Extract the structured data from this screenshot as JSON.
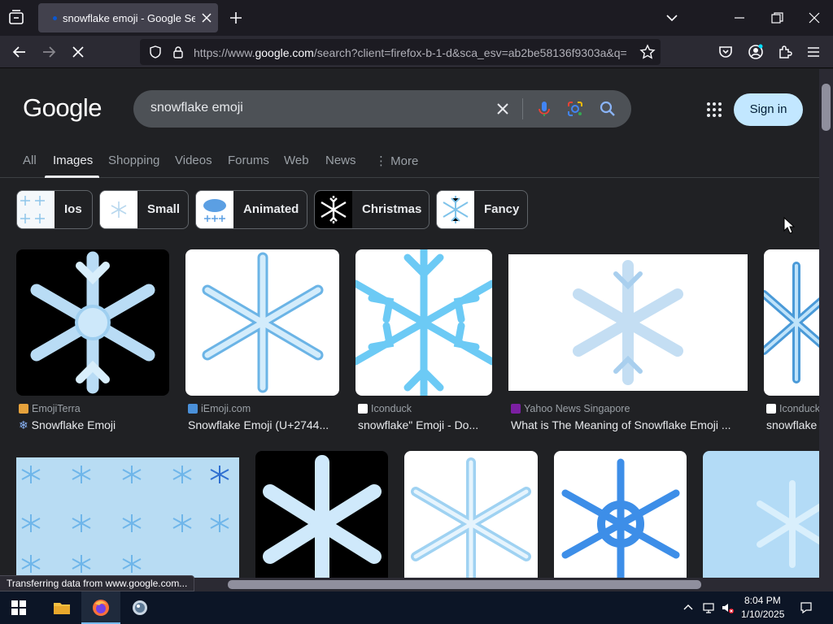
{
  "browser": {
    "tab_title": "snowflake emoji - Google Search",
    "url_prefix": "https://www.",
    "url_domain": "google.com",
    "url_path": "/search?client=firefox-b-1-d&sca_esv=ab2be58136f9303a&q=",
    "status_text": "Transferring data from www.google.com..."
  },
  "google": {
    "logo": "Google",
    "query": "snowflake emoji",
    "sign_in": "Sign in",
    "tabs": [
      "All",
      "Images",
      "Shopping",
      "Videos",
      "Forums",
      "Web",
      "News",
      "More"
    ],
    "active_tab": "Images",
    "chips": [
      "Ios",
      "Small",
      "Animated",
      "Christmas",
      "Fancy"
    ]
  },
  "results_row1": [
    {
      "source": "EmojiTerra",
      "title": "Snowflake Emoji"
    },
    {
      "source": "iEmoji.com",
      "title": "Snowflake Emoji (U+2744..."
    },
    {
      "source": "Iconduck",
      "title": "snowflake\" Emoji - Do..."
    },
    {
      "source": "Yahoo News Singapore",
      "title": "What is The Meaning of Snowflake Emoji ..."
    },
    {
      "source": "Iconduck",
      "title": "snowflake"
    }
  ],
  "taskbar": {
    "time": "8:04 PM",
    "date": "1/10/2025"
  },
  "icons": [
    "tab-list-icon",
    "close-icon",
    "plus-icon",
    "chevron-down-icon",
    "minimize-icon",
    "maximize-icon",
    "back-icon",
    "forward-icon",
    "stop-icon",
    "shield-icon",
    "lock-icon",
    "star-icon",
    "pocket-icon",
    "account-icon",
    "extensions-icon",
    "menu-icon",
    "mic-icon",
    "lens-icon",
    "search-icon",
    "apps-icon",
    "windows-icon",
    "folder-icon",
    "firefox-icon",
    "globe-icon"
  ],
  "colors": {
    "accent": "#c2e7ff",
    "page_bg": "#202124",
    "snow": "#a8d8f4"
  }
}
